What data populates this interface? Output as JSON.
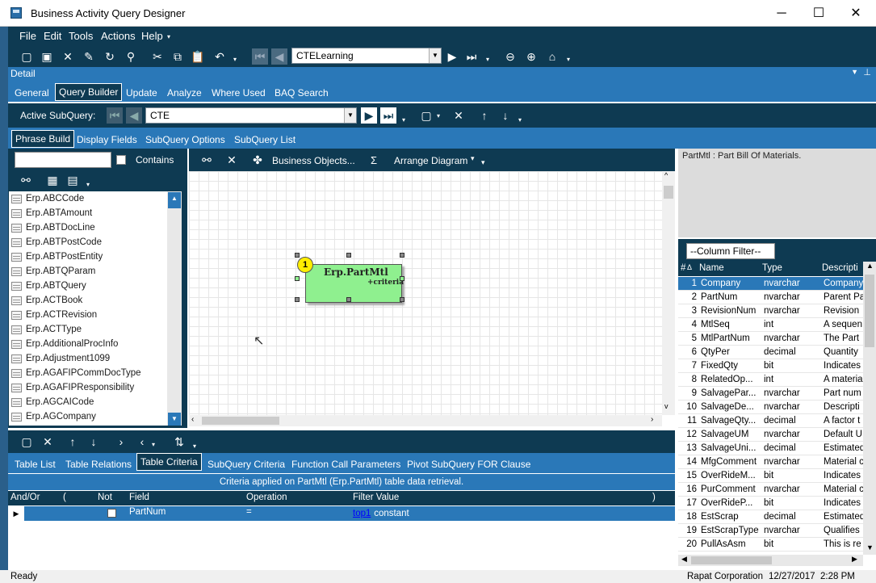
{
  "window": {
    "title": "Business Activity Query Designer",
    "min": "─",
    "max": "☐",
    "close": "✕"
  },
  "menu": [
    "File",
    "Edit",
    "Tools",
    "Actions",
    "Help"
  ],
  "toolbar": {
    "query_combo": "CTELearning"
  },
  "detail": {
    "label": "Detail"
  },
  "main_tabs": [
    "General",
    "Query Builder",
    "Update",
    "Analyze",
    "Where Used",
    "BAQ Search"
  ],
  "subquery": {
    "label": "Active SubQuery:",
    "value": "CTE"
  },
  "sub_tabs": [
    "Phrase Build",
    "Display Fields",
    "SubQuery Options",
    "SubQuery List"
  ],
  "left": {
    "search_value": "",
    "contains_label": "Contains",
    "tables": [
      "Erp.ABCCode",
      "Erp.ABTAmount",
      "Erp.ABTDocLine",
      "Erp.ABTPostCode",
      "Erp.ABTPostEntity",
      "Erp.ABTQParam",
      "Erp.ABTQuery",
      "Erp.ACTBook",
      "Erp.ACTRevision",
      "Erp.ACTType",
      "Erp.AdditionalProcInfo",
      "Erp.Adjustment1099",
      "Erp.AGAFIPCommDocType",
      "Erp.AGAFIPResponsibility",
      "Erp.AGCAICode",
      "Erp.AGCompany"
    ]
  },
  "canvas_toolbar": {
    "business_objects": "Business Objects...",
    "sigma": "Σ",
    "arrange": "Arrange Diagram"
  },
  "diagram": {
    "badge": "1",
    "table_name": "Erp.PartMtl",
    "criteria": "+criteria"
  },
  "right": {
    "description": "PartMtl : Part Bill Of Materials.",
    "column_filter": "--Column Filter--",
    "columns": [
      "#",
      "Name",
      "Type",
      "Descripti"
    ],
    "rows": [
      [
        "1",
        "Company",
        "nvarchar",
        "Company"
      ],
      [
        "2",
        "PartNum",
        "nvarchar",
        "Parent Pa"
      ],
      [
        "3",
        "RevisionNum",
        "nvarchar",
        "Revision"
      ],
      [
        "4",
        "MtlSeq",
        "int",
        "A sequen"
      ],
      [
        "5",
        "MtlPartNum",
        "nvarchar",
        "The Part"
      ],
      [
        "6",
        "QtyPer",
        "decimal",
        "Quantity"
      ],
      [
        "7",
        "FixedQty",
        "bit",
        "Indicates"
      ],
      [
        "8",
        "RelatedOp...",
        "int",
        "A materia"
      ],
      [
        "9",
        "SalvagePar...",
        "nvarchar",
        "Part num"
      ],
      [
        "10",
        "SalvageDe...",
        "nvarchar",
        "Descripti"
      ],
      [
        "11",
        "SalvageQty...",
        "decimal",
        "A factor t"
      ],
      [
        "12",
        "SalvageUM",
        "nvarchar",
        "Default U"
      ],
      [
        "13",
        "SalvageUni...",
        "decimal",
        "Estimated"
      ],
      [
        "14",
        "MfgComment",
        "nvarchar",
        "Material c"
      ],
      [
        "15",
        "OverRideM...",
        "bit",
        "Indicates"
      ],
      [
        "16",
        "PurComment",
        "nvarchar",
        "Material c"
      ],
      [
        "17",
        "OverRideP...",
        "bit",
        "Indicates"
      ],
      [
        "18",
        "EstScrap",
        "decimal",
        "Estimated"
      ],
      [
        "19",
        "EstScrapType",
        "nvarchar",
        "Qualifies"
      ],
      [
        "20",
        "PullAsAsm",
        "bit",
        "This is re"
      ]
    ]
  },
  "bottom_tabs": [
    "Table List",
    "Table Relations",
    "Table Criteria",
    "SubQuery Criteria",
    "Function Call Parameters",
    "Pivot SubQuery FOR Clause"
  ],
  "criteria": {
    "header": "Criteria applied on PartMtl (Erp.PartMtl)  table data retrieval.",
    "cols": [
      "And/Or",
      "(",
      "Not",
      "Field",
      "Operation",
      "Filter Value",
      ")"
    ],
    "row": {
      "field": "PartNum",
      "op": "=",
      "filter_link": "top1",
      "filter_rest": " constant"
    }
  },
  "status": {
    "left": "Ready",
    "company": "Rapat Corporation",
    "date": "12/27/2017",
    "time": "2:28 PM"
  }
}
